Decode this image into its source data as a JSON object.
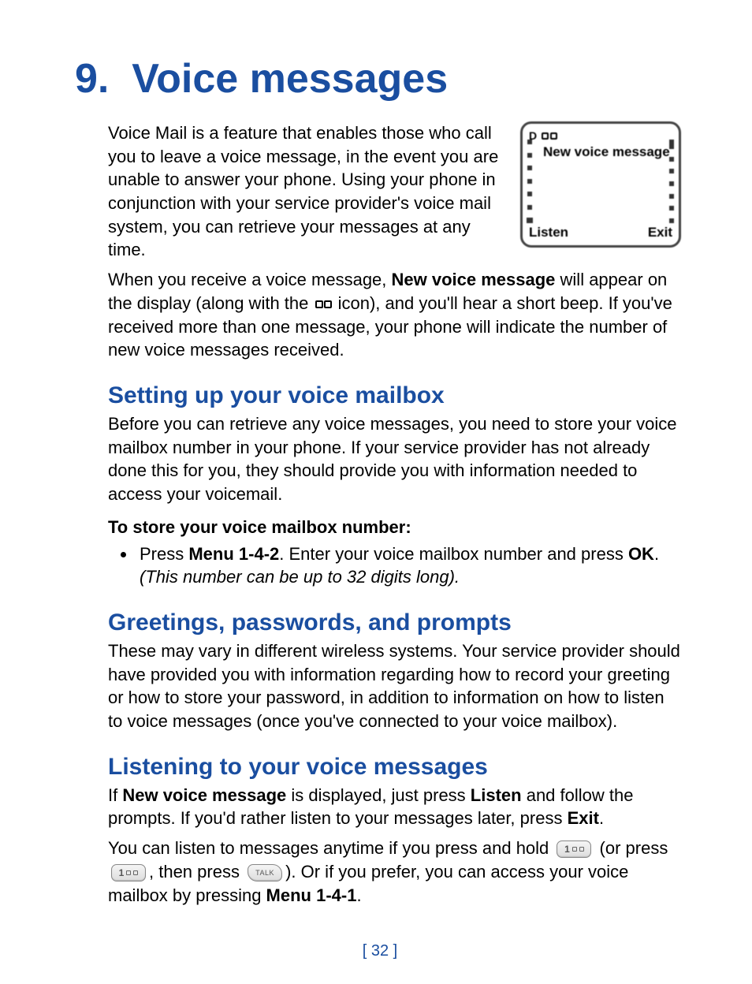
{
  "chapter": {
    "number": "9.",
    "title": "Voice messages"
  },
  "phone": {
    "top_label": "",
    "msg": "New voice message",
    "left_sk": "Listen",
    "right_sk": "Exit"
  },
  "intro": {
    "p1": "Voice Mail is a feature that enables those who call you to leave a voice message, in the event you are unable to answer your phone. Using your phone in conjunction with your service provider's voice mail system, you can retrieve your messages at any time.",
    "p2a": "When you receive a voice message, ",
    "p2b": "New voice message",
    "p2c": " will appear on the display (along with the ",
    "p2d": " icon), and you'll hear a short beep. If you've received more than one message, your phone will indicate the number of new voice messages received."
  },
  "section1": {
    "heading": "Setting up your voice mailbox",
    "p": "Before you can retrieve any voice messages, you need to store your voice mailbox number in your phone. If your service provider has not already done this for you, they should provide you with information needed to access your voicemail.",
    "sub": "To store your voice mailbox number:",
    "b1a": "Press ",
    "b1b": "Menu 1-4-2",
    "b1c": ". Enter your voice mailbox number and press ",
    "b1d": "OK",
    "b1e": ". ",
    "b1f": "(This number can be up to 32 digits long)."
  },
  "section2": {
    "heading": "Greetings, passwords, and prompts",
    "p": "These may vary in different wireless systems. Your service provider should have provided you with information regarding how to record your greeting or how to store your password, in addition to information on how to listen to voice messages (once you've connected to your voice mailbox)."
  },
  "section3": {
    "heading": "Listening to your voice messages",
    "p1a": "If ",
    "p1b": "New voice message",
    "p1c": " is displayed, just press ",
    "p1d": "Listen",
    "p1e": " and follow the prompts. If you'd rather listen to your messages later, press ",
    "p1f": "Exit",
    "p1g": ".",
    "p2a": "You can listen to messages anytime if you press and hold ",
    "p2b": " (or press ",
    "p2c": ", then press ",
    "p2d": "). Or if you prefer, you can access your voice mailbox by pressing ",
    "p2e": "Menu 1-4-1",
    "p2f": ".",
    "key1_num": "1",
    "key2_num": "1",
    "key_talk": "TALK"
  },
  "page_number": "[ 32 ]"
}
